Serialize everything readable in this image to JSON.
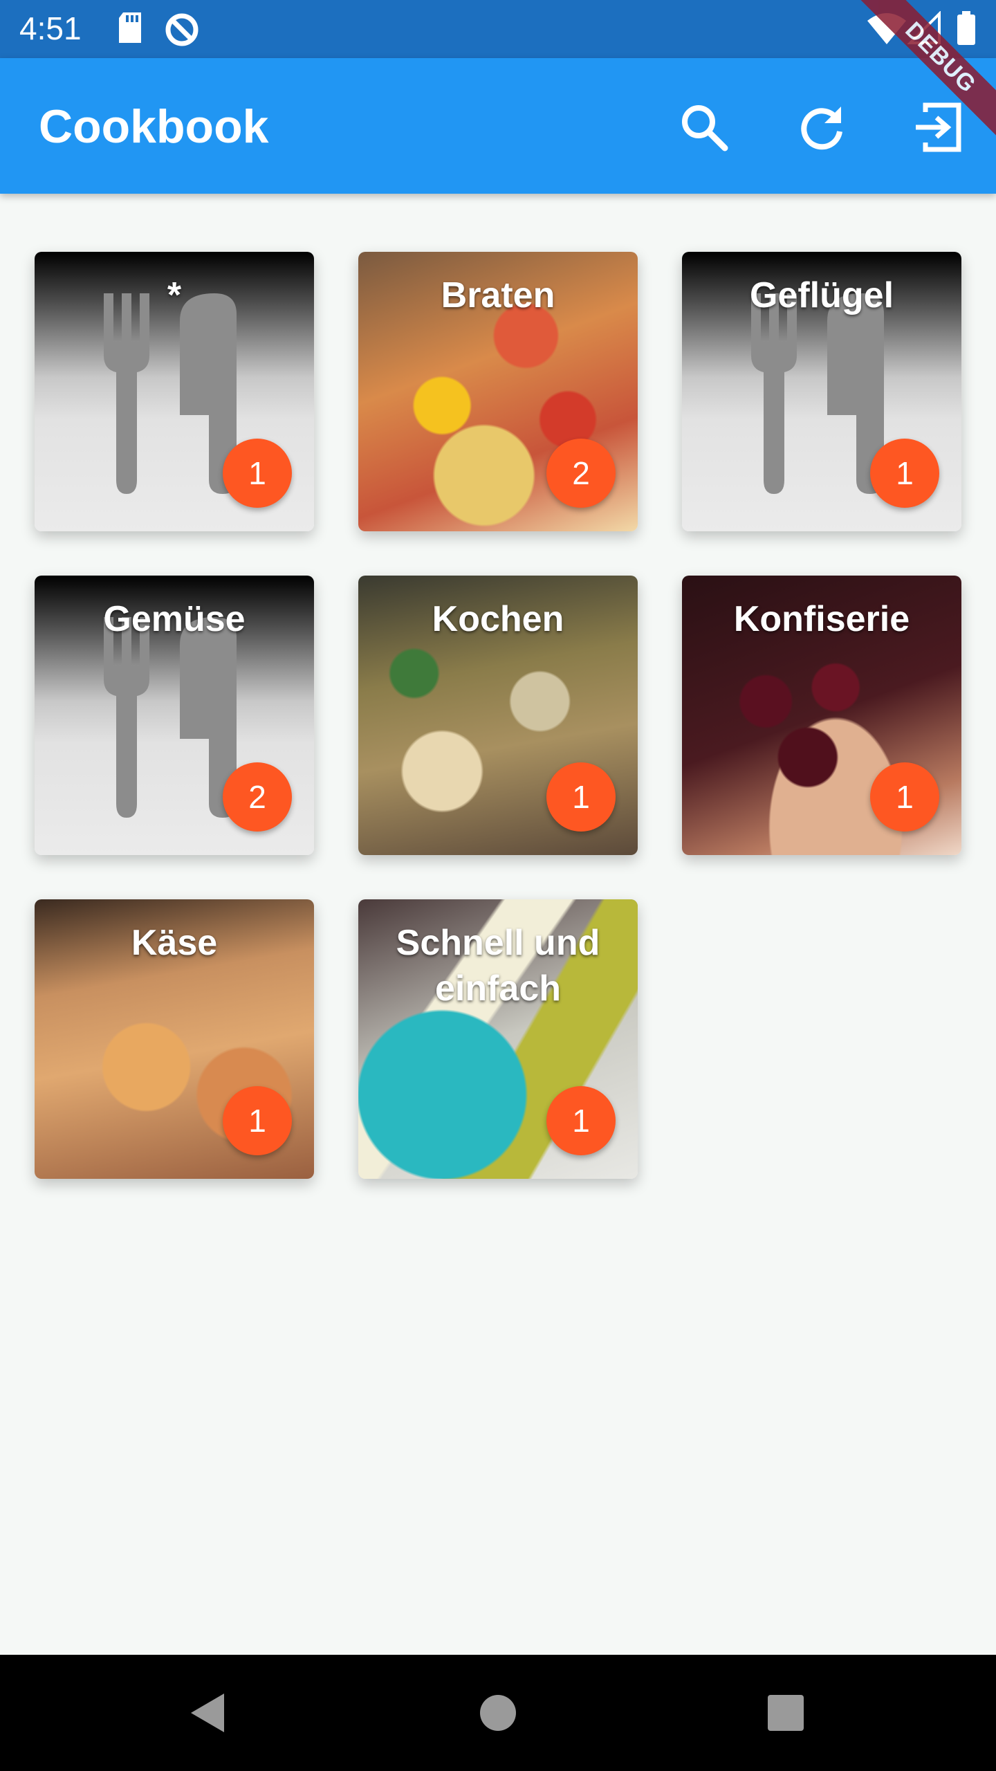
{
  "status_bar": {
    "time": "4:51",
    "icons": [
      "sd-card-icon",
      "data-saver-icon",
      "wifi-icon",
      "signal-icon",
      "battery-icon"
    ]
  },
  "debug_label": "DEBUG",
  "app_bar": {
    "title": "Cookbook",
    "actions": [
      "search-icon",
      "refresh-icon",
      "logout-icon"
    ],
    "color": "#2196f3"
  },
  "categories": [
    {
      "title": "*",
      "count": "1",
      "image": "placeholder-cutlery"
    },
    {
      "title": "Braten",
      "count": "2",
      "image": "roast-photo"
    },
    {
      "title": "Geflügel",
      "count": "1",
      "image": "placeholder-cutlery"
    },
    {
      "title": "Gemüse",
      "count": "2",
      "image": "placeholder-cutlery"
    },
    {
      "title": "Kochen",
      "count": "1",
      "image": "paella-photo"
    },
    {
      "title": "Konfiserie",
      "count": "1",
      "image": "confectionery-photo"
    },
    {
      "title": "Käse",
      "count": "1",
      "image": "cheese-pasta-photo"
    },
    {
      "title": "Schnell und einfach",
      "count": "1",
      "image": "asparagus-photo"
    }
  ],
  "badge_color": "#fe5722",
  "nav_bar": {
    "buttons": [
      "back-icon",
      "home-icon",
      "recents-icon"
    ]
  }
}
